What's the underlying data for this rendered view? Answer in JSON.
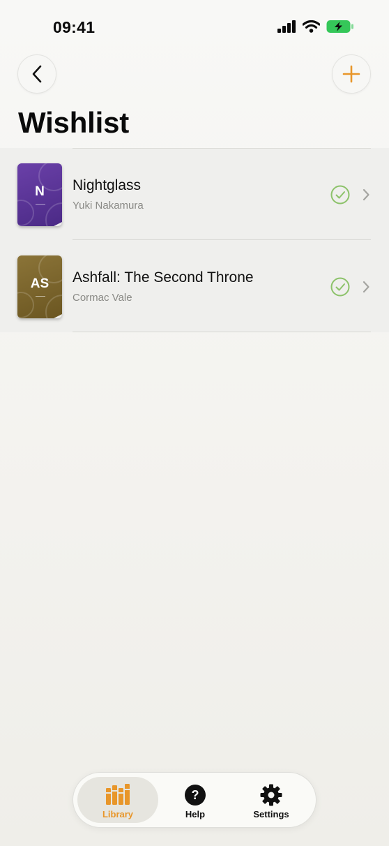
{
  "status_bar": {
    "time": "09:41",
    "icons": [
      "signal-bars-icon",
      "wifi-icon",
      "battery-charging-icon"
    ]
  },
  "nav": {
    "back_icon": "chevron-left-icon",
    "add_icon": "plus-icon"
  },
  "page": {
    "title": "Wishlist"
  },
  "books": [
    {
      "title": "Nightglass",
      "author": "Yuki Nakamura",
      "cover_initials": "N",
      "cover_color": "#5a3597",
      "status_icon": "check-circle-icon",
      "trailing_icon": "chevron-right-icon"
    },
    {
      "title": "Ashfall: The Second Throne",
      "author": "Cormac Vale",
      "cover_initials": "AS",
      "cover_color": "#7a652c",
      "status_icon": "check-circle-icon",
      "trailing_icon": "chevron-right-icon"
    }
  ],
  "tab_bar": {
    "tabs": [
      {
        "label": "Library",
        "icon": "books-icon",
        "selected": true
      },
      {
        "label": "Help",
        "icon": "question-circle-icon",
        "selected": false
      },
      {
        "label": "Settings",
        "icon": "gear-icon",
        "selected": false
      }
    ]
  },
  "colors": {
    "accent": "#e8962a",
    "check_green": "#8cc26a",
    "battery_green": "#35c759"
  }
}
